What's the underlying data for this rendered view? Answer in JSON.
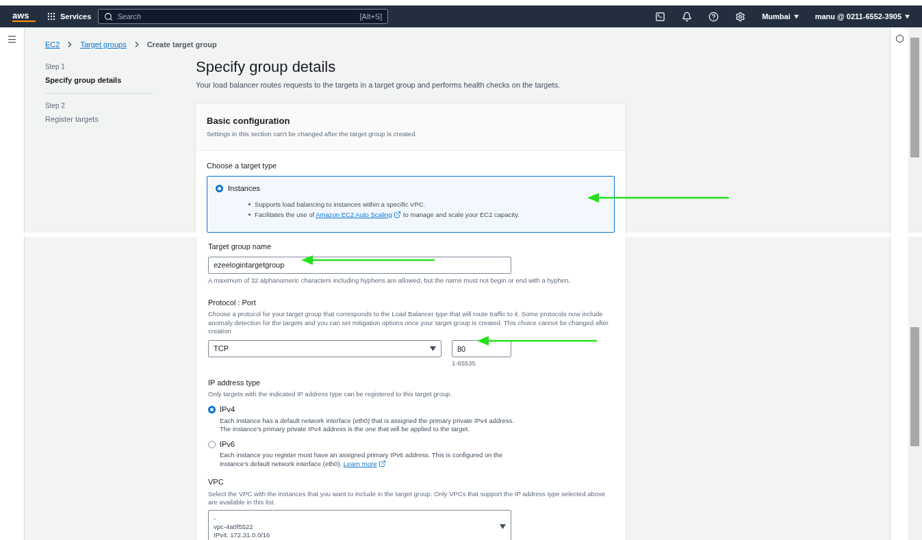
{
  "header": {
    "logo": "aws",
    "services": "Services",
    "search": {
      "placeholder": "Search",
      "shortcut": "[Alt+S]"
    },
    "region": "Mumbai",
    "account": "manu @ 0211-6552-3905"
  },
  "breadcrumbs": [
    {
      "label": "EC2",
      "kind": "link"
    },
    {
      "label": "Target groups",
      "kind": "link"
    },
    {
      "label": "Create target group",
      "kind": "current"
    }
  ],
  "steps": [
    {
      "step": "Step 1",
      "title": "Specify group details",
      "selected": true
    },
    {
      "step": "Step 2",
      "title": "Register targets",
      "selected": false
    }
  ],
  "page": {
    "title": "Specify group details",
    "description": "Your load balancer routes requests to the targets in a target group and performs health checks on the targets."
  },
  "basic_configuration": {
    "title": "Basic configuration",
    "description": "Settings in this section can't be changed after the target group is created.",
    "target_type": {
      "label": "Choose a target type",
      "options": [
        {
          "label": "Instances",
          "selected": true,
          "bullets": [
            {
              "text": "Supports load balancing to instances within a specific VPC."
            },
            {
              "text": "Facilitates the use of",
              "link": "Amazon EC2 Auto Scaling",
              "after": "to manage and scale your EC2 capacity."
            }
          ]
        }
      ]
    }
  },
  "target_group_name": {
    "label": "Target group name",
    "value": "ezeelogintargetgroup",
    "hint": "A maximum of 32 alphanumeric characters including hyphens are allowed, but the name must not begin or end with a hyphen."
  },
  "protocol_port": {
    "label": "Protocol : Port",
    "description": "Choose a protocol for your target group that corresponds to the Load Balancer type that will route traffic to it. Some protocols now include anomaly detection for the targets and you can set mitigation options once your target group is created. This choice cannot be changed after creation",
    "protocol": "TCP",
    "port": "80",
    "port_hint": "1-65535"
  },
  "ip_address_type": {
    "label": "IP address type",
    "description": "Only targets with the indicated IP address type can be registered to this target group.",
    "options": [
      {
        "label": "IPv4",
        "selected": true,
        "description": "Each instance has a default network interface (eth0) that is assigned the primary private IPv4 address. The instance's primary private IPv4 address is the one that will be applied to the target."
      },
      {
        "label": "IPv6",
        "selected": false,
        "description": "Each instance you register must have an assigned primary IPv6 address. This is configured on the instance's default network interface (eth0).",
        "link": "Learn more"
      }
    ]
  },
  "vpc": {
    "label": "VPC",
    "description": "Select the VPC with the instances that you want to include in the target group. Only VPCs that support the IP address type selected above are available in this list.",
    "lines": [
      "-",
      "vpc-4a0f5522",
      "IPv4: 172.31.0.0/16"
    ]
  }
}
